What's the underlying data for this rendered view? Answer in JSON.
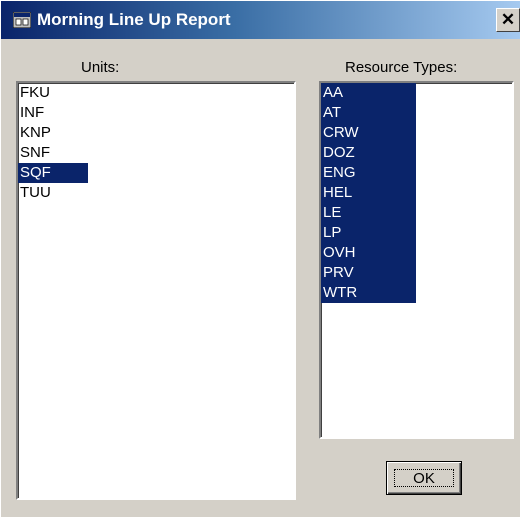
{
  "window": {
    "title": "Morning Line Up Report",
    "app_icon": "app-window-icon",
    "close_label": "✕",
    "titlebar_colors": [
      "#0a246a",
      "#3a6ea5",
      "#a6caf0"
    ],
    "face_color": "#d4d0c8",
    "selection_color": "#0a246a"
  },
  "units": {
    "label": "Units:",
    "items": [
      {
        "text": "FKU",
        "selected": false
      },
      {
        "text": "INF",
        "selected": false
      },
      {
        "text": "KNP",
        "selected": false
      },
      {
        "text": "SNF",
        "selected": false
      },
      {
        "text": "SQF",
        "selected": true
      },
      {
        "text": "TUU",
        "selected": false
      }
    ]
  },
  "resource_types": {
    "label": "Resource Types:",
    "items": [
      {
        "text": "AA",
        "selected": true
      },
      {
        "text": "AT",
        "selected": true
      },
      {
        "text": "CRW",
        "selected": true
      },
      {
        "text": "DOZ",
        "selected": true
      },
      {
        "text": "ENG",
        "selected": true
      },
      {
        "text": "HEL",
        "selected": true
      },
      {
        "text": "LE",
        "selected": true
      },
      {
        "text": "LP",
        "selected": true
      },
      {
        "text": "OVH",
        "selected": true
      },
      {
        "text": "PRV",
        "selected": true
      },
      {
        "text": "WTR",
        "selected": true
      }
    ]
  },
  "buttons": {
    "ok_label": "OK"
  }
}
